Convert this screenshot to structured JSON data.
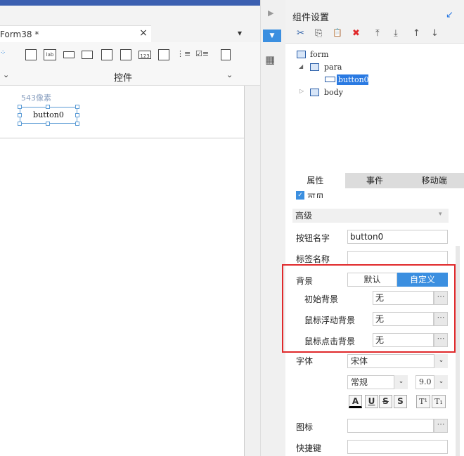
{
  "editor": {
    "tab_title": "Form38 *",
    "tab_close": "×",
    "tab_menu": "▾",
    "controls_label": "控件",
    "controls_chevron_left": "⌄",
    "controls_chevron_right": "⌄",
    "ruler_text": "543像素",
    "button_text": "button0",
    "toolbar_icons": [
      "rectangle-icon",
      "label-icon",
      "button-icon",
      "dropdown-icon",
      "panel-icon",
      "grid-icon",
      "number-icon",
      "textarea-icon",
      "radio-list-icon",
      "checkbox-list-icon",
      "preview-icon"
    ],
    "toolbar_icon_labels": [
      "",
      "lab",
      "",
      "",
      "",
      "",
      "123",
      "",
      "",
      "",
      ""
    ]
  },
  "side_strip": {
    "arrow": "▶",
    "dropdown": "▼",
    "layout": "▦"
  },
  "panel": {
    "title": "组件设置",
    "pin": "↙",
    "toolbar": {
      "cut": "✂",
      "copy": "⎘",
      "paste": "📋",
      "delete": "✖",
      "move_top": "⤒",
      "move_bottom": "⤓",
      "move_up": "↑",
      "move_down": "↓"
    },
    "tree": [
      {
        "label": "form",
        "expander": ""
      },
      {
        "label": "para",
        "expander": "◢"
      },
      {
        "label": "button0",
        "expander": ""
      },
      {
        "label": "body",
        "expander": "▷"
      }
    ],
    "tabs": [
      "属性",
      "事件",
      "移动端"
    ],
    "visible_label": "可见",
    "visible_check": "✓",
    "advanced": "高级",
    "advanced_chevron": "▾",
    "button_name_label": "按钮名字",
    "button_name_value": "button0",
    "tag_name_label": "标签名称",
    "tag_name_value": "",
    "background_label": "背景",
    "seg_default": "默认",
    "seg_custom": "自定义",
    "initial_bg_label": "初始背景",
    "initial_bg_value": "无",
    "hover_bg_label": "鼠标浮动背景",
    "hover_bg_value": "无",
    "click_bg_label": "鼠标点击背景",
    "click_bg_value": "无",
    "more": "⋯",
    "font_label": "字体",
    "font_value": "宋体",
    "style_value": "常规",
    "size_value": "9.0",
    "select_arrow": "⌄",
    "fmt_a": "A",
    "fmt_u": "U",
    "fmt_s": "S",
    "fmt_shadow": "S",
    "fmt_sup": "T¹",
    "fmt_sub": "T₁",
    "icon_label": "图标",
    "icon_value": "",
    "shortcut_label": "快捷键",
    "shortcut_value": ""
  },
  "colors": {
    "accent": "#3b8fe0",
    "highlight_border": "#e0292b",
    "selection": "#2a7ae2"
  }
}
